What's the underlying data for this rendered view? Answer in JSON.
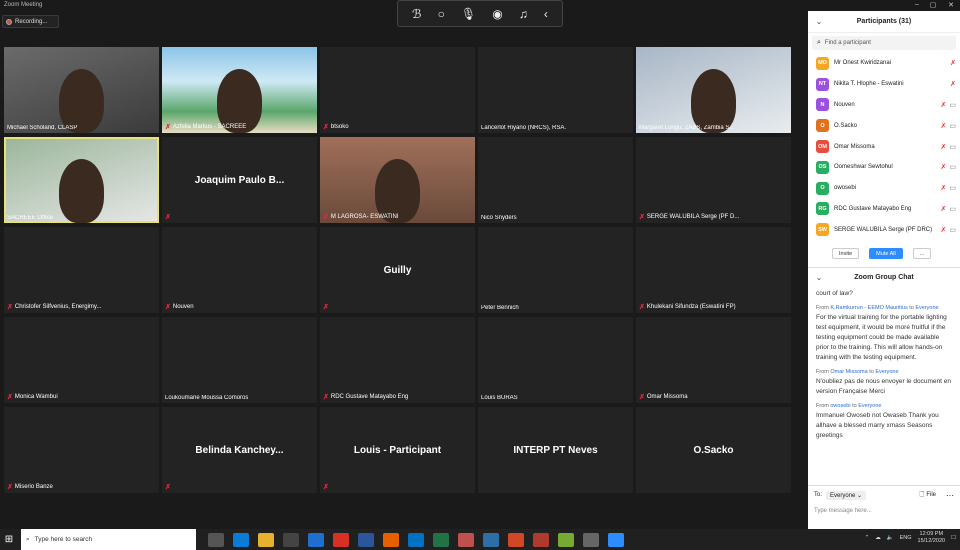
{
  "window": {
    "title": "Zoom Meeting"
  },
  "recording": {
    "label": "Recording..."
  },
  "tiles": [
    {
      "name": "Michael Scholand, CLASP",
      "muted": false
    },
    {
      "name": "Azfelia Markus - SACREEE",
      "muted": true
    },
    {
      "name": "btsoko",
      "muted": true
    },
    {
      "name": "Lancerlot Riyano (NRCS), RSA.",
      "muted": false
    },
    {
      "name": "Margaret Lungu, ZABS, Zambia S...",
      "muted": false
    },
    {
      "name": "SACREEE Office",
      "muted": false
    },
    {
      "name": "",
      "muted": true,
      "big": "Joaquim Paulo B..."
    },
    {
      "name": "M LAGROSA- ESWATINI",
      "muted": true
    },
    {
      "name": "Nico Snyders",
      "muted": false
    },
    {
      "name": "SERGE WALUBILA Serge (PF D...",
      "muted": true
    },
    {
      "name": "Christofer Silfvenius, Energimy...",
      "muted": true
    },
    {
      "name": "Nouven",
      "muted": true
    },
    {
      "name": "",
      "muted": true,
      "big": "Guilly"
    },
    {
      "name": "Peter Bennich",
      "muted": false
    },
    {
      "name": "Khulekani Sifundza (Eswatini FP)",
      "muted": true
    },
    {
      "name": "Monica Wambui",
      "muted": true
    },
    {
      "name": "Loukoumane Moussa Comoros",
      "muted": false
    },
    {
      "name": "RDC Gustave Matayabo Eng",
      "muted": true
    },
    {
      "name": "Louis BURAS",
      "muted": false
    },
    {
      "name": "Omar Missoma",
      "muted": true
    },
    {
      "name": "Miserio Banze",
      "muted": true
    },
    {
      "name": "",
      "muted": true,
      "big": "Belinda  Kanchey..."
    },
    {
      "name": "",
      "muted": true,
      "big": "Louis - Participant"
    },
    {
      "name": "",
      "muted": false,
      "big": "INTERP PT Neves"
    },
    {
      "name": "",
      "muted": false,
      "big": "O.Sacko"
    }
  ],
  "participants": {
    "title": "Participants (31)",
    "search_placeholder": "Find a participant",
    "list": [
      {
        "initials": "MO",
        "name": "Mr Onest Kwiridzanai",
        "color": "#f5a623"
      },
      {
        "initials": "NT",
        "name": "Nikita T. Hlophe - Eswatini",
        "color": "#9b51e0"
      },
      {
        "initials": "N",
        "name": "Nouven",
        "color": "#9b51e0"
      },
      {
        "initials": "O",
        "name": "O.Sacko",
        "color": "#e0721e"
      },
      {
        "initials": "OM",
        "name": "Omar Missoma",
        "color": "#e74c3c"
      },
      {
        "initials": "OS",
        "name": "Oomeshwar Sewtohul",
        "color": "#27ae60"
      },
      {
        "initials": "O",
        "name": "owosebi",
        "color": "#27ae60"
      },
      {
        "initials": "RG",
        "name": "RDC Gustave Matayabo Eng",
        "color": "#27ae60"
      },
      {
        "initials": "SW",
        "name": "SERGE WALUBILA Serge (PF DRC)",
        "color": "#f5a623"
      }
    ],
    "invite_label": "Invite",
    "mute_all_label": "Mute All",
    "more_label": "..."
  },
  "chat": {
    "title": "Zoom Group Chat",
    "messages": [
      {
        "from": "",
        "to": "",
        "text": "court of law?"
      },
      {
        "from": "K.Ramkurrun - EEMO Mauritius",
        "to": "Everyone",
        "text": "For the virtual training for the portable lighting test equipment, it would be more fruitful if the testing equipment could be made available prior to the training. This will allow hands-on training with the testing equipment."
      },
      {
        "from": "Omar Missoma",
        "to": "Everyone",
        "text": "N'oubliez pas de nous envoyer le document en version Française Merci"
      },
      {
        "from": "owosebi",
        "to": "Everyone",
        "text": "Immanuel Owoseb not Owaseb Thank you allhave a blessed marry xmass Seasons greetings"
      }
    ],
    "from_word": "From",
    "to_word": "to",
    "to_label": "To:",
    "to_value": "Everyone",
    "file_label": "File",
    "input_placeholder": "Type message here..."
  },
  "taskbar": {
    "search_placeholder": "Type here to search",
    "lang": "ENG",
    "time": "12:09 PM",
    "date": "15/12/2020"
  }
}
